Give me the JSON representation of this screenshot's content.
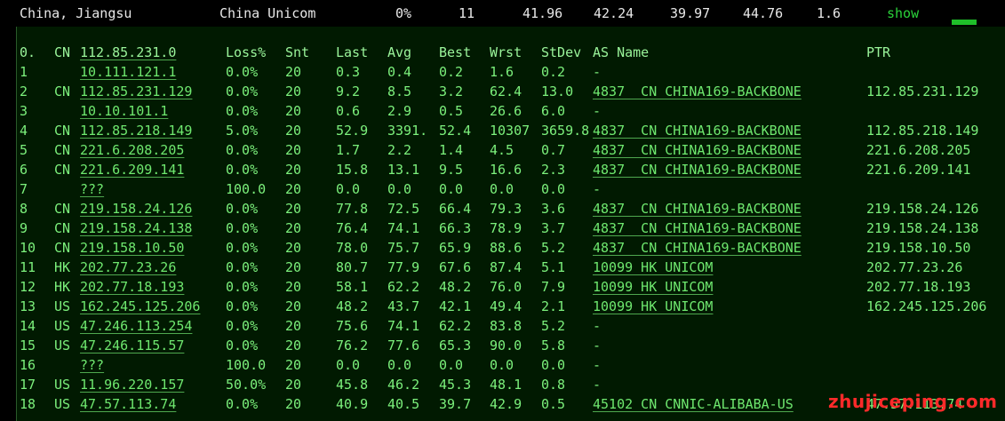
{
  "topbar": {
    "location": "China, Jiangsu",
    "isp": "China Unicom",
    "loss": "0%",
    "hops": "11",
    "v1": "41.96",
    "v2": "42.24",
    "v3": "39.97",
    "v4": "44.76",
    "v5": "1.6",
    "show_label": "show"
  },
  "header": {
    "idx": "0.",
    "cc": "CN",
    "host": "112.85.231.0",
    "loss": "Loss%",
    "snt": "Snt",
    "last": "Last",
    "avg": "Avg",
    "best": "Best",
    "wrst": "Wrst",
    "stdev": "StDev",
    "as": "AS Name",
    "ptr": "PTR"
  },
  "hops": [
    {
      "idx": "1",
      "cc": "",
      "host": "10.111.121.1",
      "loss": "0.0%",
      "snt": "20",
      "last": "0.3",
      "avg": "0.4",
      "best": "0.2",
      "wrst": "1.6",
      "stdev": "0.2",
      "as": "-",
      "ptr": ""
    },
    {
      "idx": "2",
      "cc": "CN",
      "host": "112.85.231.129",
      "loss": "0.0%",
      "snt": "20",
      "last": "9.2",
      "avg": "8.5",
      "best": "3.2",
      "wrst": "62.4",
      "stdev": "13.0",
      "as": "4837  CN CHINA169-BACKBONE",
      "ptr": "112.85.231.129"
    },
    {
      "idx": "3",
      "cc": "",
      "host": "10.10.101.1",
      "loss": "0.0%",
      "snt": "20",
      "last": "0.6",
      "avg": "2.9",
      "best": "0.5",
      "wrst": "26.6",
      "stdev": "6.0",
      "as": "-",
      "ptr": ""
    },
    {
      "idx": "4",
      "cc": "CN",
      "host": "112.85.218.149",
      "loss": "5.0%",
      "snt": "20",
      "last": "52.9",
      "avg": "3391.",
      "best": "52.4",
      "wrst": "10307",
      "stdev": "3659.8",
      "as": "4837  CN CHINA169-BACKBONE",
      "ptr": "112.85.218.149"
    },
    {
      "idx": "5",
      "cc": "CN",
      "host": "221.6.208.205",
      "loss": "0.0%",
      "snt": "20",
      "last": "1.7",
      "avg": "2.2",
      "best": "1.4",
      "wrst": "4.5",
      "stdev": "0.7",
      "as": "4837  CN CHINA169-BACKBONE",
      "ptr": "221.6.208.205"
    },
    {
      "idx": "6",
      "cc": "CN",
      "host": "221.6.209.141",
      "loss": "0.0%",
      "snt": "20",
      "last": "15.8",
      "avg": "13.1",
      "best": "9.5",
      "wrst": "16.6",
      "stdev": "2.3",
      "as": "4837  CN CHINA169-BACKBONE",
      "ptr": "221.6.209.141"
    },
    {
      "idx": "7",
      "cc": "",
      "host": "???",
      "loss": "100.0",
      "snt": "20",
      "last": "0.0",
      "avg": "0.0",
      "best": "0.0",
      "wrst": "0.0",
      "stdev": "0.0",
      "as": "-",
      "ptr": ""
    },
    {
      "idx": "8",
      "cc": "CN",
      "host": "219.158.24.126",
      "loss": "0.0%",
      "snt": "20",
      "last": "77.8",
      "avg": "72.5",
      "best": "66.4",
      "wrst": "79.3",
      "stdev": "3.6",
      "as": "4837  CN CHINA169-BACKBONE",
      "ptr": "219.158.24.126"
    },
    {
      "idx": "9",
      "cc": "CN",
      "host": "219.158.24.138",
      "loss": "0.0%",
      "snt": "20",
      "last": "76.4",
      "avg": "74.1",
      "best": "66.3",
      "wrst": "78.9",
      "stdev": "3.7",
      "as": "4837  CN CHINA169-BACKBONE",
      "ptr": "219.158.24.138"
    },
    {
      "idx": "10",
      "cc": "CN",
      "host": "219.158.10.50",
      "loss": "0.0%",
      "snt": "20",
      "last": "78.0",
      "avg": "75.7",
      "best": "65.9",
      "wrst": "88.6",
      "stdev": "5.2",
      "as": "4837  CN CHINA169-BACKBONE",
      "ptr": "219.158.10.50"
    },
    {
      "idx": "11",
      "cc": "HK",
      "host": "202.77.23.26",
      "loss": "0.0%",
      "snt": "20",
      "last": "80.7",
      "avg": "77.9",
      "best": "67.6",
      "wrst": "87.4",
      "stdev": "5.1",
      "as": "10099 HK UNICOM",
      "ptr": "202.77.23.26"
    },
    {
      "idx": "12",
      "cc": "HK",
      "host": "202.77.18.193",
      "loss": "0.0%",
      "snt": "20",
      "last": "58.1",
      "avg": "62.2",
      "best": "48.2",
      "wrst": "76.0",
      "stdev": "7.9",
      "as": "10099 HK UNICOM",
      "ptr": "202.77.18.193"
    },
    {
      "idx": "13",
      "cc": "US",
      "host": "162.245.125.206",
      "loss": "0.0%",
      "snt": "20",
      "last": "48.2",
      "avg": "43.7",
      "best": "42.1",
      "wrst": "49.4",
      "stdev": "2.1",
      "as": "10099 HK UNICOM",
      "ptr": "162.245.125.206"
    },
    {
      "idx": "14",
      "cc": "US",
      "host": "47.246.113.254",
      "loss": "0.0%",
      "snt": "20",
      "last": "75.6",
      "avg": "74.1",
      "best": "62.2",
      "wrst": "83.8",
      "stdev": "5.2",
      "as": "-",
      "ptr": ""
    },
    {
      "idx": "15",
      "cc": "US",
      "host": "47.246.115.57",
      "loss": "0.0%",
      "snt": "20",
      "last": "76.2",
      "avg": "77.6",
      "best": "65.3",
      "wrst": "90.0",
      "stdev": "5.8",
      "as": "-",
      "ptr": ""
    },
    {
      "idx": "16",
      "cc": "",
      "host": "???",
      "loss": "100.0",
      "snt": "20",
      "last": "0.0",
      "avg": "0.0",
      "best": "0.0",
      "wrst": "0.0",
      "stdev": "0.0",
      "as": "-",
      "ptr": ""
    },
    {
      "idx": "17",
      "cc": "US",
      "host": "11.96.220.157",
      "loss": "50.0%",
      "snt": "20",
      "last": "45.8",
      "avg": "46.2",
      "best": "45.3",
      "wrst": "48.1",
      "stdev": "0.8",
      "as": "-",
      "ptr": ""
    },
    {
      "idx": "18",
      "cc": "US",
      "host": "47.57.113.74",
      "loss": "0.0%",
      "snt": "20",
      "last": "40.9",
      "avg": "40.5",
      "best": "39.7",
      "wrst": "42.9",
      "stdev": "0.5",
      "as": "45102 CN CNNIC-ALIBABA-US",
      "ptr": "47.57.113.74"
    }
  ],
  "watermark": "zhujiceping.com",
  "colors": {
    "text": "#7cf07c",
    "background": "#011a01",
    "watermark": "#ff2a2a"
  }
}
